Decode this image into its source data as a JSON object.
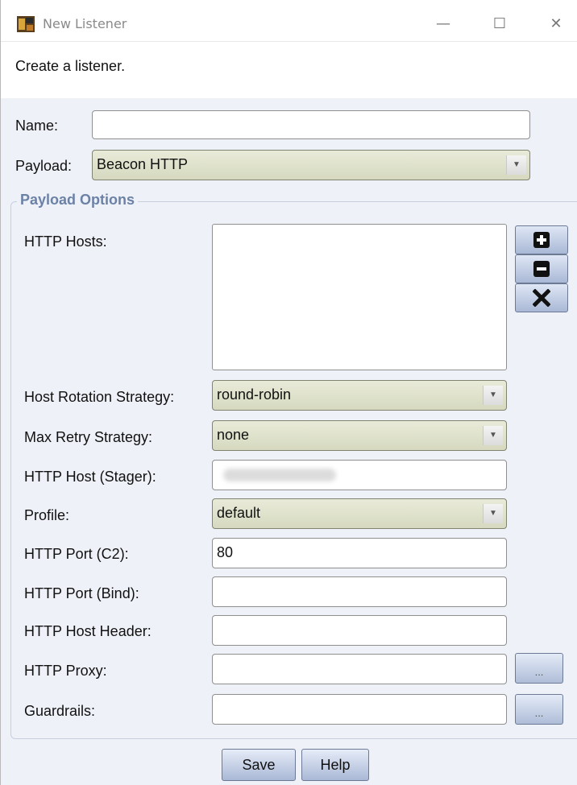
{
  "window": {
    "title": "New Listener",
    "controls": {
      "minimize": "—",
      "maximize": "☐",
      "close": "✕"
    }
  },
  "description": "Create a listener.",
  "form": {
    "name_label": "Name:",
    "name_value": "",
    "payload_label": "Payload:",
    "payload_value": "Beacon HTTP"
  },
  "payload_options": {
    "legend": "Payload Options",
    "http_hosts_label": "HTTP Hosts:",
    "http_hosts": [],
    "host_rotation_label": "Host Rotation Strategy:",
    "host_rotation_value": "round-robin",
    "max_retry_label": "Max Retry Strategy:",
    "max_retry_value": "none",
    "stager_host_label": "HTTP Host (Stager):",
    "profile_label": "Profile:",
    "profile_value": "default",
    "port_c2_label": "HTTP Port (C2):",
    "port_c2_value": "80",
    "port_bind_label": "HTTP Port (Bind):",
    "port_bind_value": "",
    "host_header_label": "HTTP Host Header:",
    "host_header_value": "",
    "proxy_label": "HTTP Proxy:",
    "proxy_value": "",
    "guardrails_label": "Guardrails:",
    "guardrails_value": "",
    "browse_label": "..."
  },
  "buttons": {
    "save": "Save",
    "help": "Help"
  },
  "icons": {
    "app": "listener-app-icon",
    "add": "plus-icon",
    "remove": "minus-icon",
    "clear": "x-icon",
    "dropdown": "chevron-down-icon"
  },
  "colors": {
    "combo_bg": "#dfe2c8",
    "section_title": "#6b82a6",
    "button": "#b7c4de"
  }
}
